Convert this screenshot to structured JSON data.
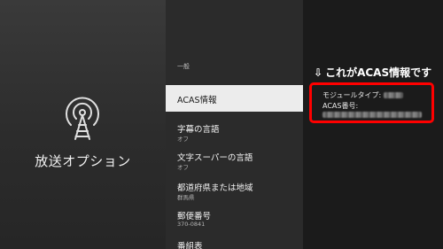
{
  "left_panel": {
    "icon": "antenna-broadcast-icon",
    "title": "放送オプション"
  },
  "menu": {
    "section_header": "一般",
    "items": [
      {
        "label": "ACAS情報",
        "value": "",
        "selected": true
      },
      {
        "label": "字幕の言語",
        "value": "オフ",
        "selected": false
      },
      {
        "label": "文字スーパーの言語",
        "value": "オフ",
        "selected": false
      },
      {
        "label": "都道府県または地域",
        "value": "群馬県",
        "selected": false
      },
      {
        "label": "郵便番号",
        "value": "370-0841",
        "selected": false
      },
      {
        "label": "番組表",
        "value": "",
        "selected": false
      }
    ]
  },
  "detail": {
    "annotation": "これがACAS情報です",
    "annotation_arrow": "⇩",
    "model_type_label": "モジュールタイプ:",
    "acas_number_label": "ACAS番号:",
    "highlight_color": "#ff0000"
  }
}
